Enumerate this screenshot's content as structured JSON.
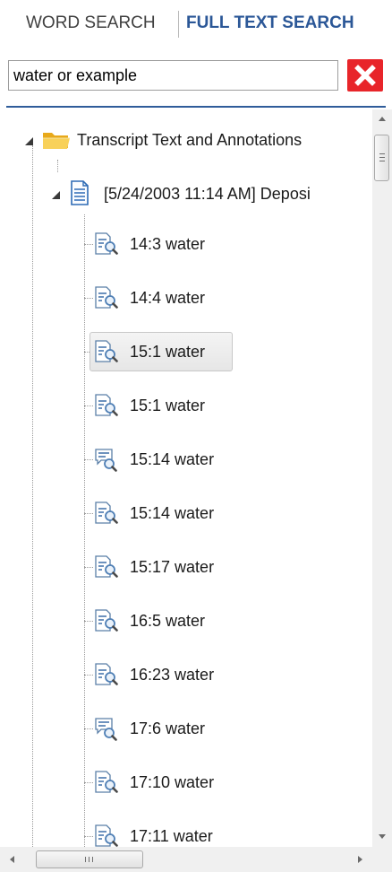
{
  "tabs": {
    "word_search": "WORD SEARCH",
    "full_text_search": "FULL TEXT SEARCH"
  },
  "search": {
    "value": "water or example"
  },
  "tree": {
    "root": {
      "label": "Transcript Text and Annotations",
      "expanded": true
    },
    "document": {
      "label": "[5/24/2003 11:14 AM]  Deposi",
      "expanded": true
    },
    "items": [
      {
        "label": "14:3 water",
        "icon": "text-search-icon",
        "selected": false
      },
      {
        "label": "14:4 water",
        "icon": "text-search-icon",
        "selected": false
      },
      {
        "label": "15:1 water",
        "icon": "text-search-icon",
        "selected": true
      },
      {
        "label": "15:1 water",
        "icon": "text-search-icon",
        "selected": false
      },
      {
        "label": "15:14 water",
        "icon": "annotation-search-icon",
        "selected": false
      },
      {
        "label": "15:14 water",
        "icon": "text-search-icon",
        "selected": false
      },
      {
        "label": "15:17 water",
        "icon": "text-search-icon",
        "selected": false
      },
      {
        "label": "16:5 water",
        "icon": "text-search-icon",
        "selected": false
      },
      {
        "label": "16:23 water",
        "icon": "text-search-icon",
        "selected": false
      },
      {
        "label": "17:6 water",
        "icon": "annotation-search-icon",
        "selected": false
      },
      {
        "label": "17:10 water",
        "icon": "text-search-icon",
        "selected": false
      },
      {
        "label": "17:11 water",
        "icon": "text-search-icon",
        "selected": false
      }
    ]
  },
  "scrollbars": {
    "vertical": true,
    "horizontal": true
  },
  "colors": {
    "accent": "#2b5797",
    "clear_button": "#e8252a",
    "folder": "#f3c33b",
    "document": "#2e6bb5"
  }
}
